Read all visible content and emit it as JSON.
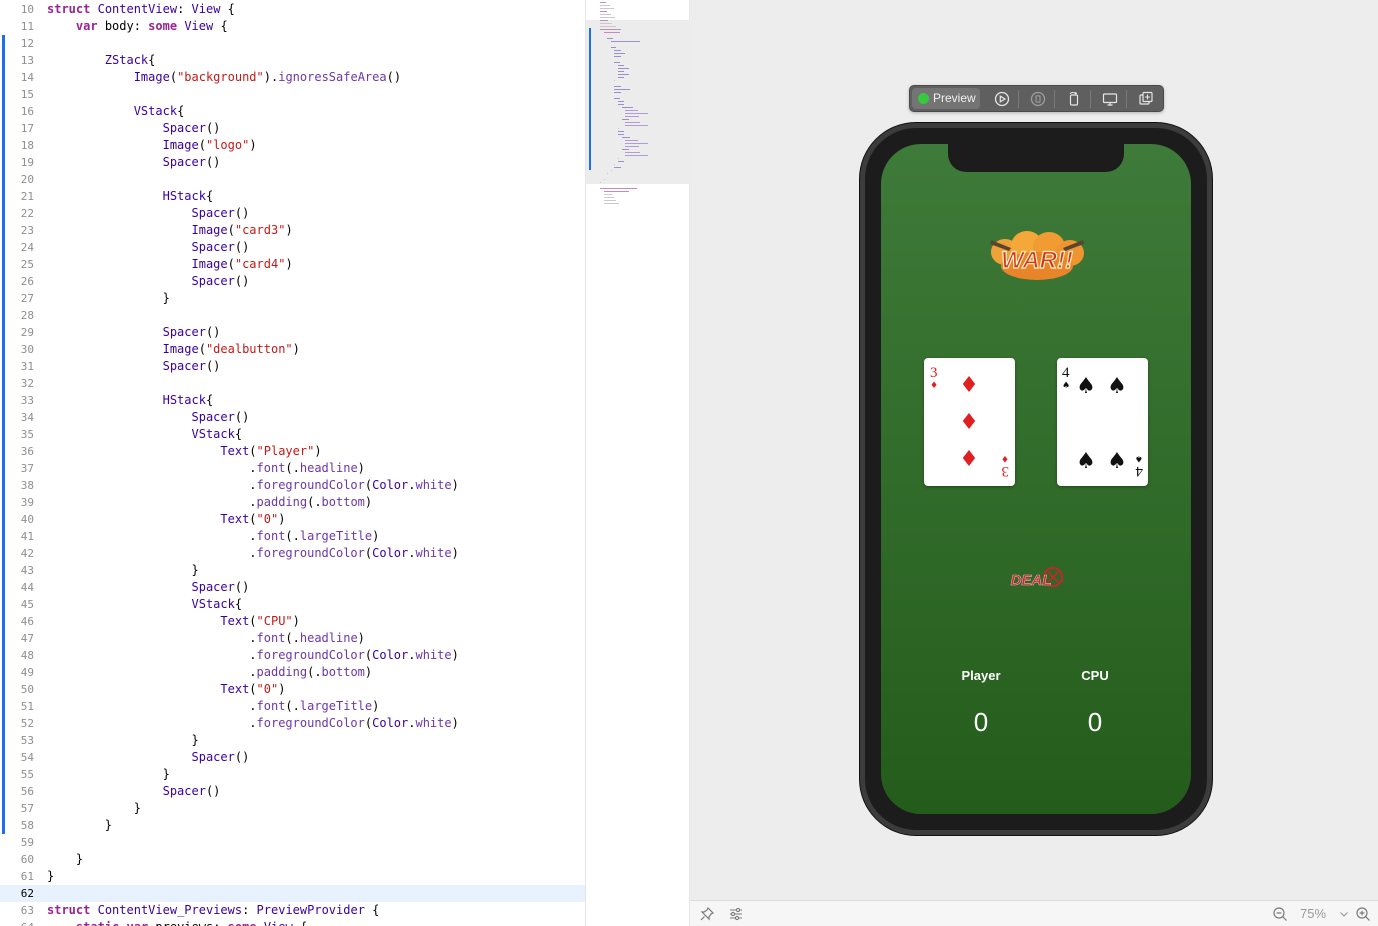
{
  "editor": {
    "current_line": 62,
    "change_bar_start": 12,
    "change_bar_end": 58,
    "lines": [
      {
        "n": 10,
        "tokens": [
          [
            "kw",
            "struct"
          ],
          [
            "p",
            " "
          ],
          [
            "type",
            "ContentView"
          ],
          [
            "p",
            ": "
          ],
          [
            "type",
            "View"
          ],
          [
            "p",
            " {"
          ]
        ]
      },
      {
        "n": 11,
        "tokens": [
          [
            "p",
            "    "
          ],
          [
            "kw",
            "var"
          ],
          [
            "p",
            " body: "
          ],
          [
            "kw",
            "some"
          ],
          [
            "p",
            " "
          ],
          [
            "type",
            "View"
          ],
          [
            "p",
            " {"
          ]
        ]
      },
      {
        "n": 12,
        "tokens": []
      },
      {
        "n": 13,
        "tokens": [
          [
            "p",
            "        "
          ],
          [
            "type",
            "ZStack"
          ],
          [
            "p",
            "{"
          ]
        ]
      },
      {
        "n": 14,
        "tokens": [
          [
            "p",
            "            "
          ],
          [
            "type",
            "Image"
          ],
          [
            "p",
            "("
          ],
          [
            "str",
            "\"background\""
          ],
          [
            "p",
            ")."
          ],
          [
            "mem",
            "ignoresSafeArea"
          ],
          [
            "p",
            "()"
          ]
        ]
      },
      {
        "n": 15,
        "tokens": []
      },
      {
        "n": 16,
        "tokens": [
          [
            "p",
            "            "
          ],
          [
            "type",
            "VStack"
          ],
          [
            "p",
            "{"
          ]
        ]
      },
      {
        "n": 17,
        "tokens": [
          [
            "p",
            "                "
          ],
          [
            "type",
            "Spacer"
          ],
          [
            "p",
            "()"
          ]
        ]
      },
      {
        "n": 18,
        "tokens": [
          [
            "p",
            "                "
          ],
          [
            "type",
            "Image"
          ],
          [
            "p",
            "("
          ],
          [
            "str",
            "\"logo\""
          ],
          [
            "p",
            ")"
          ]
        ]
      },
      {
        "n": 19,
        "tokens": [
          [
            "p",
            "                "
          ],
          [
            "type",
            "Spacer"
          ],
          [
            "p",
            "()"
          ]
        ]
      },
      {
        "n": 20,
        "tokens": []
      },
      {
        "n": 21,
        "tokens": [
          [
            "p",
            "                "
          ],
          [
            "type",
            "HStack"
          ],
          [
            "p",
            "{"
          ]
        ]
      },
      {
        "n": 22,
        "tokens": [
          [
            "p",
            "                    "
          ],
          [
            "type",
            "Spacer"
          ],
          [
            "p",
            "()"
          ]
        ]
      },
      {
        "n": 23,
        "tokens": [
          [
            "p",
            "                    "
          ],
          [
            "type",
            "Image"
          ],
          [
            "p",
            "("
          ],
          [
            "str",
            "\"card3\""
          ],
          [
            "p",
            ")"
          ]
        ]
      },
      {
        "n": 24,
        "tokens": [
          [
            "p",
            "                    "
          ],
          [
            "type",
            "Spacer"
          ],
          [
            "p",
            "()"
          ]
        ]
      },
      {
        "n": 25,
        "tokens": [
          [
            "p",
            "                    "
          ],
          [
            "type",
            "Image"
          ],
          [
            "p",
            "("
          ],
          [
            "str",
            "\"card4\""
          ],
          [
            "p",
            ")"
          ]
        ]
      },
      {
        "n": 26,
        "tokens": [
          [
            "p",
            "                    "
          ],
          [
            "type",
            "Spacer"
          ],
          [
            "p",
            "()"
          ]
        ]
      },
      {
        "n": 27,
        "tokens": [
          [
            "p",
            "                }"
          ]
        ]
      },
      {
        "n": 28,
        "tokens": []
      },
      {
        "n": 29,
        "tokens": [
          [
            "p",
            "                "
          ],
          [
            "type",
            "Spacer"
          ],
          [
            "p",
            "()"
          ]
        ]
      },
      {
        "n": 30,
        "tokens": [
          [
            "p",
            "                "
          ],
          [
            "type",
            "Image"
          ],
          [
            "p",
            "("
          ],
          [
            "str",
            "\"dealbutton\""
          ],
          [
            "p",
            ")"
          ]
        ]
      },
      {
        "n": 31,
        "tokens": [
          [
            "p",
            "                "
          ],
          [
            "type",
            "Spacer"
          ],
          [
            "p",
            "()"
          ]
        ]
      },
      {
        "n": 32,
        "tokens": []
      },
      {
        "n": 33,
        "tokens": [
          [
            "p",
            "                "
          ],
          [
            "type",
            "HStack"
          ],
          [
            "p",
            "{"
          ]
        ]
      },
      {
        "n": 34,
        "tokens": [
          [
            "p",
            "                    "
          ],
          [
            "type",
            "Spacer"
          ],
          [
            "p",
            "()"
          ]
        ]
      },
      {
        "n": 35,
        "tokens": [
          [
            "p",
            "                    "
          ],
          [
            "type",
            "VStack"
          ],
          [
            "p",
            "{"
          ]
        ]
      },
      {
        "n": 36,
        "tokens": [
          [
            "p",
            "                        "
          ],
          [
            "type",
            "Text"
          ],
          [
            "p",
            "("
          ],
          [
            "str",
            "\"Player\""
          ],
          [
            "p",
            ")"
          ]
        ]
      },
      {
        "n": 37,
        "tokens": [
          [
            "p",
            "                            ."
          ],
          [
            "mem",
            "font"
          ],
          [
            "p",
            "(."
          ],
          [
            "mem",
            "headline"
          ],
          [
            "p",
            ")"
          ]
        ]
      },
      {
        "n": 38,
        "tokens": [
          [
            "p",
            "                            ."
          ],
          [
            "mem",
            "foregroundColor"
          ],
          [
            "p",
            "("
          ],
          [
            "type",
            "Color"
          ],
          [
            "p",
            "."
          ],
          [
            "mem",
            "white"
          ],
          [
            "p",
            ")"
          ]
        ]
      },
      {
        "n": 39,
        "tokens": [
          [
            "p",
            "                            ."
          ],
          [
            "mem",
            "padding"
          ],
          [
            "p",
            "(."
          ],
          [
            "mem",
            "bottom"
          ],
          [
            "p",
            ")"
          ]
        ]
      },
      {
        "n": 40,
        "tokens": [
          [
            "p",
            "                        "
          ],
          [
            "type",
            "Text"
          ],
          [
            "p",
            "("
          ],
          [
            "str",
            "\"0\""
          ],
          [
            "p",
            ")"
          ]
        ]
      },
      {
        "n": 41,
        "tokens": [
          [
            "p",
            "                            ."
          ],
          [
            "mem",
            "font"
          ],
          [
            "p",
            "(."
          ],
          [
            "mem",
            "largeTitle"
          ],
          [
            "p",
            ")"
          ]
        ]
      },
      {
        "n": 42,
        "tokens": [
          [
            "p",
            "                            ."
          ],
          [
            "mem",
            "foregroundColor"
          ],
          [
            "p",
            "("
          ],
          [
            "type",
            "Color"
          ],
          [
            "p",
            "."
          ],
          [
            "mem",
            "white"
          ],
          [
            "p",
            ")"
          ]
        ]
      },
      {
        "n": 43,
        "tokens": [
          [
            "p",
            "                    }"
          ]
        ]
      },
      {
        "n": 44,
        "tokens": [
          [
            "p",
            "                    "
          ],
          [
            "type",
            "Spacer"
          ],
          [
            "p",
            "()"
          ]
        ]
      },
      {
        "n": 45,
        "tokens": [
          [
            "p",
            "                    "
          ],
          [
            "type",
            "VStack"
          ],
          [
            "p",
            "{"
          ]
        ]
      },
      {
        "n": 46,
        "tokens": [
          [
            "p",
            "                        "
          ],
          [
            "type",
            "Text"
          ],
          [
            "p",
            "("
          ],
          [
            "str",
            "\"CPU\""
          ],
          [
            "p",
            ")"
          ]
        ]
      },
      {
        "n": 47,
        "tokens": [
          [
            "p",
            "                            ."
          ],
          [
            "mem",
            "font"
          ],
          [
            "p",
            "(."
          ],
          [
            "mem",
            "headline"
          ],
          [
            "p",
            ")"
          ]
        ]
      },
      {
        "n": 48,
        "tokens": [
          [
            "p",
            "                            ."
          ],
          [
            "mem",
            "foregroundColor"
          ],
          [
            "p",
            "("
          ],
          [
            "type",
            "Color"
          ],
          [
            "p",
            "."
          ],
          [
            "mem",
            "white"
          ],
          [
            "p",
            ")"
          ]
        ]
      },
      {
        "n": 49,
        "tokens": [
          [
            "p",
            "                            ."
          ],
          [
            "mem",
            "padding"
          ],
          [
            "p",
            "(."
          ],
          [
            "mem",
            "bottom"
          ],
          [
            "p",
            ")"
          ]
        ]
      },
      {
        "n": 50,
        "tokens": [
          [
            "p",
            "                        "
          ],
          [
            "type",
            "Text"
          ],
          [
            "p",
            "("
          ],
          [
            "str",
            "\"0\""
          ],
          [
            "p",
            ")"
          ]
        ]
      },
      {
        "n": 51,
        "tokens": [
          [
            "p",
            "                            ."
          ],
          [
            "mem",
            "font"
          ],
          [
            "p",
            "(."
          ],
          [
            "mem",
            "largeTitle"
          ],
          [
            "p",
            ")"
          ]
        ]
      },
      {
        "n": 52,
        "tokens": [
          [
            "p",
            "                            ."
          ],
          [
            "mem",
            "foregroundColor"
          ],
          [
            "p",
            "("
          ],
          [
            "type",
            "Color"
          ],
          [
            "p",
            "."
          ],
          [
            "mem",
            "white"
          ],
          [
            "p",
            ")"
          ]
        ]
      },
      {
        "n": 53,
        "tokens": [
          [
            "p",
            "                    }"
          ]
        ]
      },
      {
        "n": 54,
        "tokens": [
          [
            "p",
            "                    "
          ],
          [
            "type",
            "Spacer"
          ],
          [
            "p",
            "()"
          ]
        ]
      },
      {
        "n": 55,
        "tokens": [
          [
            "p",
            "                }"
          ]
        ]
      },
      {
        "n": 56,
        "tokens": [
          [
            "p",
            "                "
          ],
          [
            "type",
            "Spacer"
          ],
          [
            "p",
            "()"
          ]
        ]
      },
      {
        "n": 57,
        "tokens": [
          [
            "p",
            "            }"
          ]
        ]
      },
      {
        "n": 58,
        "tokens": [
          [
            "p",
            "        }"
          ]
        ]
      },
      {
        "n": 59,
        "tokens": []
      },
      {
        "n": 60,
        "tokens": [
          [
            "p",
            "    }"
          ]
        ]
      },
      {
        "n": 61,
        "tokens": [
          [
            "p",
            "}"
          ]
        ]
      },
      {
        "n": 62,
        "tokens": []
      },
      {
        "n": 63,
        "tokens": [
          [
            "kw",
            "struct"
          ],
          [
            "p",
            " "
          ],
          [
            "type",
            "ContentView_Previews"
          ],
          [
            "p",
            ": "
          ],
          [
            "type",
            "PreviewProvider"
          ],
          [
            "p",
            " {"
          ]
        ]
      },
      {
        "n": 64,
        "tokens": [
          [
            "p",
            "    "
          ],
          [
            "kw",
            "static"
          ],
          [
            "p",
            " "
          ],
          [
            "kw",
            "var"
          ],
          [
            "p",
            " previews: "
          ],
          [
            "kw",
            "some"
          ],
          [
            "p",
            " "
          ],
          [
            "type",
            "View"
          ],
          [
            "p",
            " {"
          ]
        ]
      }
    ]
  },
  "preview_toolbar": {
    "label": "Preview",
    "buttons": [
      "live-preview-icon",
      "inspect-icon",
      "rotate-device-icon",
      "device-settings-icon",
      "duplicate-preview-icon"
    ]
  },
  "app_preview": {
    "logo_text": "WAR!!",
    "card_left": {
      "rank": "3",
      "suit": "♦",
      "color": "#e02020"
    },
    "card_right": {
      "rank": "4",
      "suit": "♠",
      "color": "#111111"
    },
    "deal_text": "DEAL",
    "player_label": "Player",
    "player_score": "0",
    "cpu_label": "CPU",
    "cpu_score": "0"
  },
  "bottom_bar": {
    "left_icons": [
      "pin-icon",
      "adjust-icon"
    ],
    "zoom_level": "75%"
  },
  "colors": {
    "keyword": "#9b2393",
    "type": "#3900a0",
    "string": "#c41a16",
    "member": "#6c36a9",
    "accent": "#1e6eea",
    "background_green": "#336d2c"
  }
}
